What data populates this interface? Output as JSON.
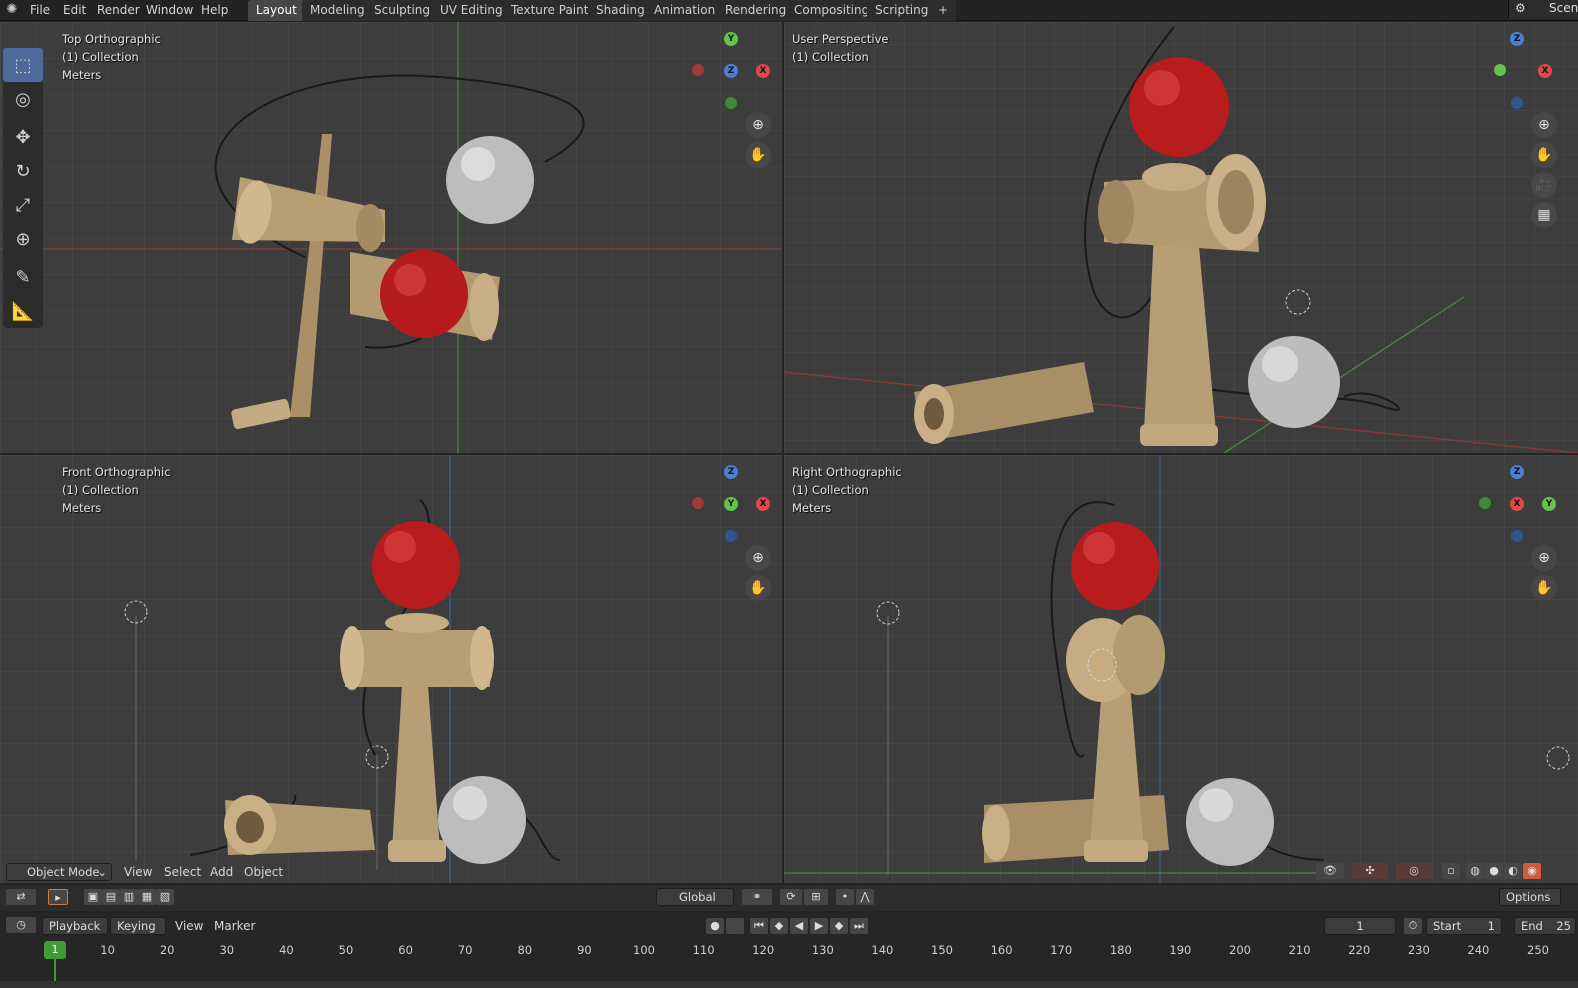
{
  "app": {
    "icon": "blender-logo-icon"
  },
  "menu": [
    "File",
    "Edit",
    "Render",
    "Window",
    "Help"
  ],
  "workspaces": [
    "Layout",
    "Modeling",
    "Sculpting",
    "UV Editing",
    "Texture Paint",
    "Shading",
    "Animation",
    "Rendering",
    "Compositing",
    "Scripting",
    "+"
  ],
  "active_workspace": "Layout",
  "scene_label": "Scen",
  "viewports": {
    "top": {
      "view": "Top Orthographic",
      "collection": "(1) Collection",
      "units": "Meters",
      "gizmo": {
        "up": "Y",
        "center": "Z",
        "right": "X"
      }
    },
    "persp": {
      "view": "User Perspective",
      "collection": "(1) Collection",
      "gizmo": {
        "up": "Z",
        "right": "X"
      }
    },
    "front": {
      "view": "Front Orthographic",
      "collection": "(1) Collection",
      "units": "Meters",
      "gizmo": {
        "up": "Z",
        "center": "Y",
        "right": "X"
      }
    },
    "right": {
      "view": "Right Orthographic",
      "collection": "(1) Collection",
      "units": "Meters",
      "gizmo": {
        "up": "Z",
        "center": "X",
        "right": "Y"
      }
    }
  },
  "tools": [
    "select-box-icon",
    "cursor-icon",
    "move-icon",
    "rotate-icon",
    "scale-icon",
    "transform-icon",
    "annotate-icon",
    "measure-icon"
  ],
  "viewport_header": {
    "mode": "Object Mode",
    "menus": [
      "View",
      "Select",
      "Add",
      "Object"
    ]
  },
  "tool_header": {
    "orientation": "Global",
    "options": "Options"
  },
  "timeline_header": {
    "menus": [
      "Playback",
      "Keying",
      "View",
      "Marker"
    ],
    "current_frame": "1",
    "start_label": "Start",
    "start_value": "1",
    "end_label": "End",
    "end_value": "25"
  },
  "timeline_ticks": [
    "1",
    "10",
    "20",
    "30",
    "40",
    "50",
    "60",
    "70",
    "80",
    "90",
    "100",
    "110",
    "120",
    "130",
    "140",
    "150",
    "160",
    "170",
    "180",
    "190",
    "200",
    "210",
    "220",
    "230",
    "240",
    "250"
  ],
  "colors": {
    "accent": "#4d6a9a",
    "frame": "#3e9b35",
    "x_axis": "#e04848",
    "y_axis": "#63c34b",
    "z_axis": "#4a7fd1",
    "ball_red": "#c41e1e",
    "ball_silver": "#c8c8c8",
    "wood": "#b89e74"
  }
}
